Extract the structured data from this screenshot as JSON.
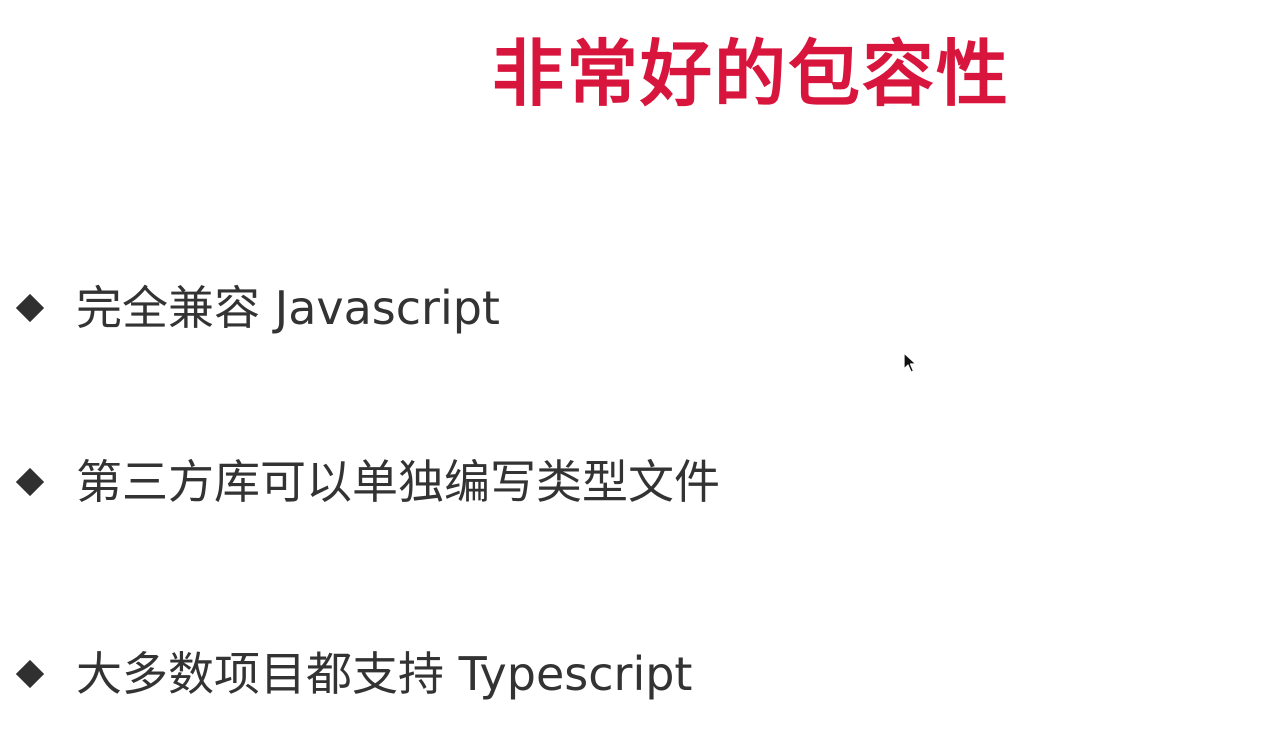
{
  "slide": {
    "title": "非常好的包容性",
    "title_color": "#d8163d",
    "text_color": "#333333",
    "bullet_color": "#303030",
    "bullets": [
      {
        "icon": "diamond-bullet-icon",
        "text": "完全兼容 Javascript"
      },
      {
        "icon": "diamond-bullet-icon",
        "text": "第三方库可以单独编写类型文件"
      },
      {
        "icon": "diamond-bullet-icon",
        "text": "大多数项目都支持 Typescript"
      }
    ]
  },
  "cursor": {
    "icon": "mouse-pointer-icon"
  }
}
